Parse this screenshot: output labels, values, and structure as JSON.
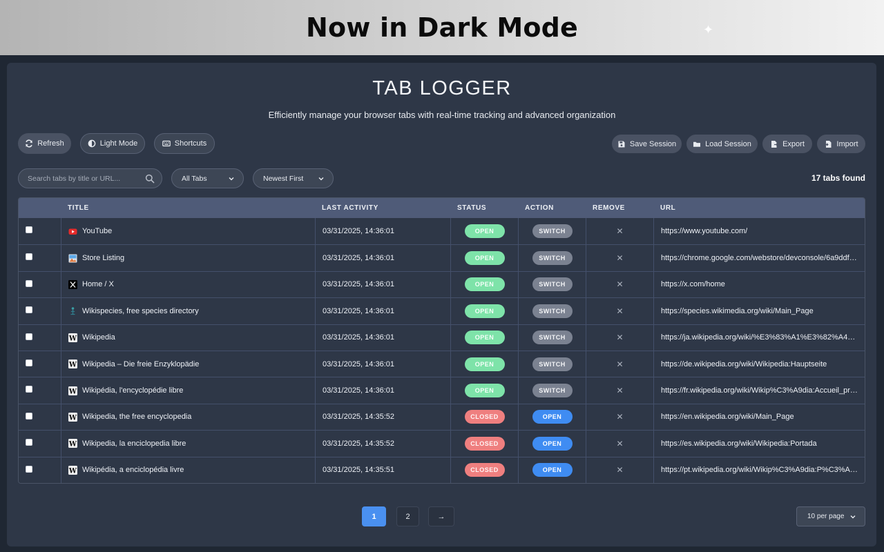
{
  "banner": {
    "title": "Now in Dark Mode"
  },
  "app": {
    "title": "TAB LOGGER",
    "subtitle": "Efficiently manage your browser tabs with real-time tracking and advanced organization"
  },
  "toolbar": {
    "refresh": "Refresh",
    "light_mode": "Light Mode",
    "shortcuts": "Shortcuts",
    "save_session": "Save Session",
    "load_session": "Load Session",
    "export": "Export",
    "import": "Import"
  },
  "filters": {
    "search_placeholder": "Search tabs by title or URL...",
    "tab_filter": "All Tabs",
    "sort": "Newest First",
    "count": "17 tabs found"
  },
  "table": {
    "headers": {
      "title": "TITLE",
      "last_activity": "LAST ACTIVITY",
      "status": "STATUS",
      "action": "ACTION",
      "remove": "REMOVE",
      "url": "URL"
    },
    "rows": [
      {
        "icon": "youtube-icon",
        "title": "YouTube",
        "time": "03/31/2025, 14:36:01",
        "status": "OPEN",
        "action": "SWITCH",
        "url": "https://www.youtube.com/"
      },
      {
        "icon": "store-icon",
        "title": "Store Listing",
        "time": "03/31/2025, 14:36:01",
        "status": "OPEN",
        "action": "SWITCH",
        "url": "https://chrome.google.com/webstore/devconsole/6a9ddf33..."
      },
      {
        "icon": "x-logo-icon",
        "title": "Home / X",
        "time": "03/31/2025, 14:36:01",
        "status": "OPEN",
        "action": "SWITCH",
        "url": "https://x.com/home"
      },
      {
        "icon": "wikispecies-icon",
        "title": "Wikispecies, free species directory",
        "time": "03/31/2025, 14:36:01",
        "status": "OPEN",
        "action": "SWITCH",
        "url": "https://species.wikimedia.org/wiki/Main_Page"
      },
      {
        "icon": "wikipedia-icon",
        "title": "Wikipedia",
        "time": "03/31/2025, 14:36:01",
        "status": "OPEN",
        "action": "SWITCH",
        "url": "https://ja.wikipedia.org/wiki/%E3%83%A1%E3%82%A4%..."
      },
      {
        "icon": "wikipedia-icon",
        "title": "Wikipedia – Die freie Enzyklopädie",
        "time": "03/31/2025, 14:36:01",
        "status": "OPEN",
        "action": "SWITCH",
        "url": "https://de.wikipedia.org/wiki/Wikipedia:Hauptseite"
      },
      {
        "icon": "wikipedia-icon",
        "title": "Wikipédia, l'encyclopédie libre",
        "time": "03/31/2025, 14:36:01",
        "status": "OPEN",
        "action": "SWITCH",
        "url": "https://fr.wikipedia.org/wiki/Wikip%C3%A9dia:Accueil_prin..."
      },
      {
        "icon": "wikipedia-icon",
        "title": "Wikipedia, the free encyclopedia",
        "time": "03/31/2025, 14:35:52",
        "status": "CLOSED",
        "action": "OPEN",
        "url": "https://en.wikipedia.org/wiki/Main_Page"
      },
      {
        "icon": "wikipedia-icon",
        "title": "Wikipedia, la enciclopedia libre",
        "time": "03/31/2025, 14:35:52",
        "status": "CLOSED",
        "action": "OPEN",
        "url": "https://es.wikipedia.org/wiki/Wikipedia:Portada"
      },
      {
        "icon": "wikipedia-icon",
        "title": "Wikipédia, a enciclopédia livre",
        "time": "03/31/2025, 14:35:51",
        "status": "CLOSED",
        "action": "OPEN",
        "url": "https://pt.wikipedia.org/wiki/Wikip%C3%A9dia:P%C3%A1g..."
      }
    ],
    "remove_symbol": "✕"
  },
  "pagination": {
    "pages": [
      "1",
      "2"
    ],
    "active": "1",
    "next": "→",
    "per_page": "10 per page"
  },
  "colors": {
    "open_status": "#7ee3a9",
    "closed_status": "#ef7f7f",
    "switch_action": "#7b8291",
    "open_action": "#3f8cf2",
    "accent": "#4a90f0"
  }
}
